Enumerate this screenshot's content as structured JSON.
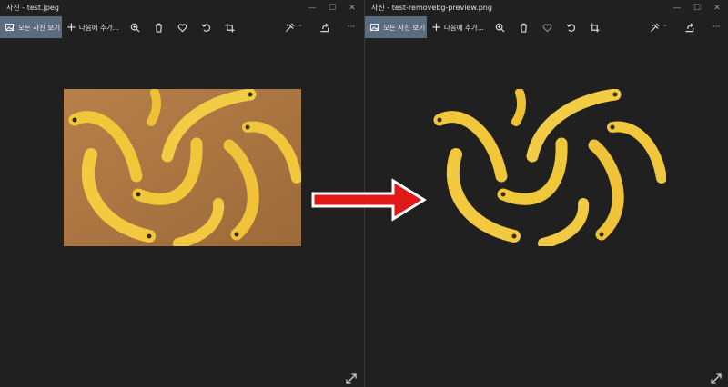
{
  "left": {
    "title": "사진 - test.jpeg",
    "all_photos": "모든 사진 보기",
    "add_to": "다음에 추가..."
  },
  "right": {
    "title": "사진 - test-removebg-preview.png",
    "all_photos": "모든 사진 보기",
    "add_to": "다음에 추가..."
  },
  "window_controls": {
    "minimize": "—",
    "maximize": "☐",
    "close": "✕"
  },
  "toolbar_icons": [
    "zoom-icon",
    "delete-icon",
    "favorite-icon",
    "rotate-icon",
    "crop-icon",
    "edit-create-icon",
    "share-icon",
    "more-icon"
  ],
  "more_label": "···",
  "colors": {
    "background": "#202020",
    "all_photos_button": "#5b6b80",
    "photo_background": "#a9753f",
    "banana": "#f1c73a",
    "arrow": "#e01818"
  }
}
